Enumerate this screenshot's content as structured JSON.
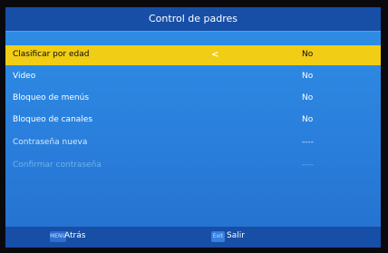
{
  "title": "Control de padres",
  "menu": {
    "items": [
      {
        "label": "Clasificar por edad",
        "value": "No"
      },
      {
        "label": "Video",
        "value": "No"
      },
      {
        "label": "Bloqueo de menús",
        "value": "No"
      },
      {
        "label": "Bloqueo de canales",
        "value": "No"
      },
      {
        "label": "Contraseña nueva",
        "value": "----"
      },
      {
        "label": "Confirmar contraseña",
        "value": "----"
      }
    ],
    "selected_index": 0,
    "selected_arrow": "<"
  },
  "footer": {
    "menu_key": "MENU",
    "back_label": "Atrás",
    "exit_key": "Exit",
    "exit_label": "Salir"
  },
  "colors": {
    "panel": "#2a7fdc",
    "bars": "#174ea6",
    "highlight": "#f1cd15"
  }
}
